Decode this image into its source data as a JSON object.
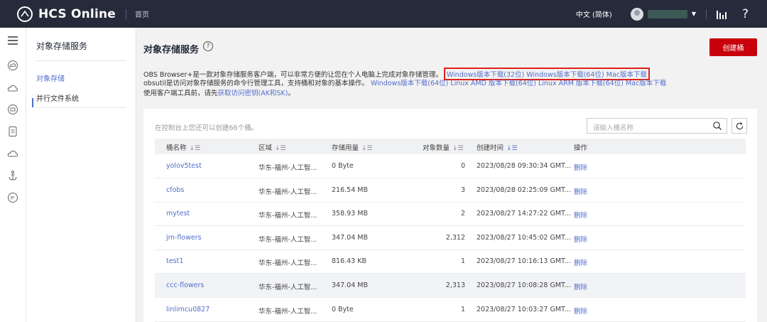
{
  "header": {
    "logo_text": "HCS Online",
    "home_link": "首页",
    "language": "中文 (简体)",
    "help_glyph": "?"
  },
  "rail_icons": [
    "menu-icon",
    "cloud-icon",
    "cloud-server-icon",
    "database-icon",
    "storage-icon",
    "cloud-icon",
    "anchor-icon",
    "ip-icon"
  ],
  "service_nav": {
    "title": "对象存储服务",
    "items": [
      {
        "label": "对象存储",
        "active": true
      },
      {
        "label": "并行文件系统",
        "active": false
      }
    ]
  },
  "page": {
    "title": "对象存储服务",
    "help_glyph": "?",
    "create_button": "创建桶"
  },
  "description": {
    "line1_text": "OBS Browser+是一款对象存储服务客户端，可以非常方便的让您在个人电脑上完成对象存储管理。",
    "line1_links": [
      "Windows版本下载(32位)",
      "Windows版本下载(64位)",
      "Mac版本下载"
    ],
    "line2_text": "obsutil是访问对象存储服务的命令行管理工具，支持桶和对象的基本操作。",
    "line2_links": [
      "Windows版本下载(64位)",
      "Linux AMD 版本下载(64位)",
      "Linux ARM 版本下载(64位)",
      "Mac版本下载"
    ],
    "line3_text": "使用客户端工具前，请先",
    "line3_link": "获取访问密钥(AK和SK)",
    "line3_end": "。"
  },
  "table": {
    "quota_text": "在控制台上您还可以创建66个桶。",
    "search_placeholder": "请输入桶名称",
    "columns": {
      "name": "桶名称",
      "region": "区域",
      "storage": "存储用量",
      "objects": "对象数量",
      "created": "创建时间",
      "actions": "操作"
    },
    "rows": [
      {
        "name": "yolov5test",
        "region": "华东-福州-人工智...",
        "storage": "0 Byte",
        "objects": "0",
        "created": "2023/08/28 09:30:34 GMT...",
        "action": "删除",
        "highlight": false
      },
      {
        "name": "cfobs",
        "region": "华东-福州-人工智...",
        "storage": "216.54 MB",
        "objects": "3",
        "created": "2023/08/28 02:25:09 GMT...",
        "action": "删除",
        "highlight": false
      },
      {
        "name": "mytest",
        "region": "华东-福州-人工智...",
        "storage": "358.93 MB",
        "objects": "2",
        "created": "2023/08/27 14:27:22 GMT...",
        "action": "删除",
        "highlight": false
      },
      {
        "name": "jm-flowers",
        "region": "华东-福州-人工智...",
        "storage": "347.04 MB",
        "objects": "2,312",
        "created": "2023/08/27 10:45:02 GMT...",
        "action": "删除",
        "highlight": false
      },
      {
        "name": "test1",
        "region": "华东-福州-人工智...",
        "storage": "816.43 KB",
        "objects": "1",
        "created": "2023/08/27 10:16:13 GMT...",
        "action": "删除",
        "highlight": false
      },
      {
        "name": "ccc-flowers",
        "region": "华东-福州-人工智...",
        "storage": "347.04 MB",
        "objects": "2,313",
        "created": "2023/08/27 10:08:28 GMT...",
        "action": "删除",
        "highlight": true
      },
      {
        "name": "linlimcu0827",
        "region": "华东-福州-人工智...",
        "storage": "0 Byte",
        "objects": "1",
        "created": "2023/08/27 10:03:27 GMT...",
        "action": "删除",
        "highlight": false
      }
    ]
  },
  "colors": {
    "topbar": "#252b3a",
    "accent_link": "#526ecc",
    "primary_button": "#c7000b",
    "highlight_box": "#e0211c"
  }
}
